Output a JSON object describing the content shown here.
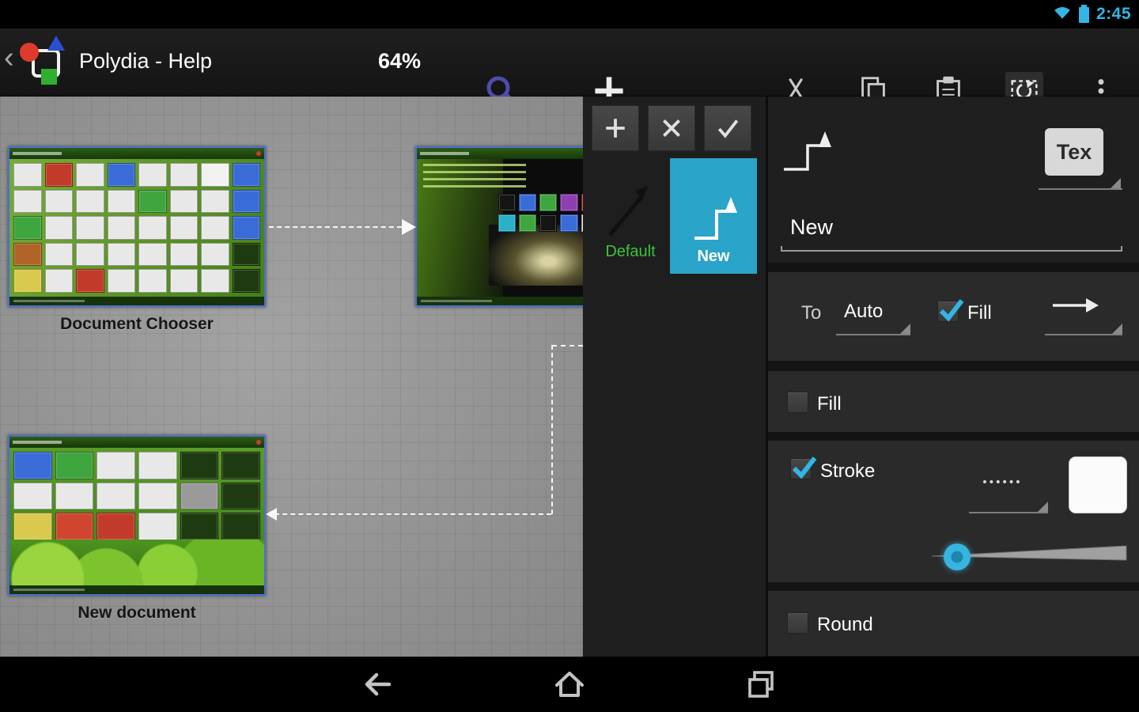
{
  "status_bar": {
    "time": "2:45"
  },
  "action_bar": {
    "back_glyph": "‹",
    "title": "Polydia - Help",
    "zoom_level": "64%"
  },
  "canvas": {
    "nodes": [
      {
        "label": "Document Chooser",
        "tiles": [
          "wrwbwwnb",
          "wwwwgwwb",
          "gwwwwwwb",
          "owwwwwwd",
          "ywrwwwwd"
        ]
      },
      {
        "label": "",
        "tiles": [
          "kbgmr",
          "cgkbw"
        ]
      },
      {
        "label": "New document",
        "tiles": [
          "bgwwdd",
          "wwwwtd",
          "yprwdd"
        ]
      }
    ]
  },
  "tile_colors": {
    "w": "#e8e8e8",
    "r": "#c23b2a",
    "b": "#3a6cd8",
    "g": "#3fa53f",
    "o": "#b06428",
    "y": "#d9c94e",
    "d": "#1d3a10",
    "t": "#9a9a9a",
    "k": "#141414",
    "m": "#8e3fb0",
    "c": "#2ab0c8",
    "n": "#f2f2f2",
    "p": "#d0452f"
  },
  "side_panel": {
    "styles": [
      {
        "label": "Default"
      },
      {
        "label": "New"
      }
    ],
    "properties": {
      "type_button": "Tex",
      "name_value": "New",
      "to_label": "To",
      "to_value": "Auto",
      "to_fill_label": "Fill",
      "fill_label": "Fill",
      "stroke_label": "Stroke",
      "round_label": "Round",
      "checks": {
        "to_fill": true,
        "fill": false,
        "stroke": true,
        "round": false
      },
      "stroke_slider_fraction": 0.06
    }
  },
  "colors": {
    "accent_blue": "#33b5e5",
    "selected_style_bg": "#2ba4c9",
    "default_label_green": "#3bc43b"
  }
}
